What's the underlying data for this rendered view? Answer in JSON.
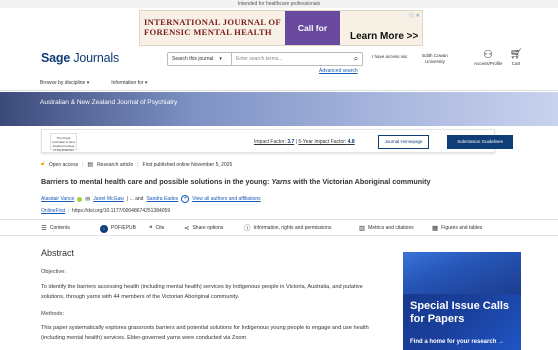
{
  "topbar": {
    "text": "Intended for healthcare professionals"
  },
  "ad": {
    "title": "INTERNATIONAL JOURNAL OF FORENSIC MENTAL HEALTH",
    "cfp": "Call for papers",
    "learn": "Learn More >>"
  },
  "header": {
    "logo_bold": "Sage",
    "logo_rest": "Journals",
    "search_scope": "Search this journal",
    "search_placeholder": "Enter search terms...",
    "advanced": "Advanced search",
    "access": "I have access via:",
    "institution": "Edith Cowan University",
    "account": "Access/Profile",
    "cart": "Cart",
    "nav_browse": "Browse by discipline",
    "nav_info": "Information for"
  },
  "banner": {
    "title": "Australian & New Zealand Journal of Psychiatry"
  },
  "journal": {
    "logo_text": "The Royal Australian & New Zealand College of Psychiatrists",
    "impact_label": "Impact Factor:",
    "impact_value": "3.7",
    "impact5_label": "5-Year Impact Factor:",
    "impact5_value": "4.8",
    "home_btn": "Journal Homepage",
    "sub_btn": "Submission Guidelines"
  },
  "meta": {
    "open_access": "Open access",
    "type": "Research article",
    "published": "First published online November 5, 2025"
  },
  "article": {
    "title_pre": "Barriers to mental health care and possible solutions in the young: ",
    "title_em": "Yarns",
    "title_post": " with the Victorian Aboriginal community",
    "author1": "Alasdair Vance",
    "author2": "Janet McGaw",
    "author_sep": "| ... and",
    "author3": "Sandra Eades",
    "view_all": "View all authors and affiliations",
    "onlinefirst": "OnlineFirst",
    "doi": "https://doi.org/10.1177/00048674251384059"
  },
  "toolbar": {
    "contents": "Contents",
    "pdf": "PDF/EPUB",
    "cite": "Cite",
    "share": "Share options",
    "info": "Information, rights and permissions",
    "metrics": "Metrics and citations",
    "figures": "Figures and tables"
  },
  "abstract": {
    "heading": "Abstract",
    "objective_label": "Objective:",
    "objective_text": "To identify the barriers accessing health (including mental health) services by Indigenous people in Victoria, Australia, and putative solutions, through yarns with 44 members of the Victorian Aboriginal community.",
    "methods_label": "Methods:",
    "methods_text": "This paper systematically explores grassroots barriers and potential solutions for Indigenous young people to engage and use health (including mental health) services. Elder-governed yarns were conducted via Zoom"
  },
  "side_ad": {
    "title": "Special Issue Calls for Papers",
    "cta": "Find a home for your research →"
  }
}
